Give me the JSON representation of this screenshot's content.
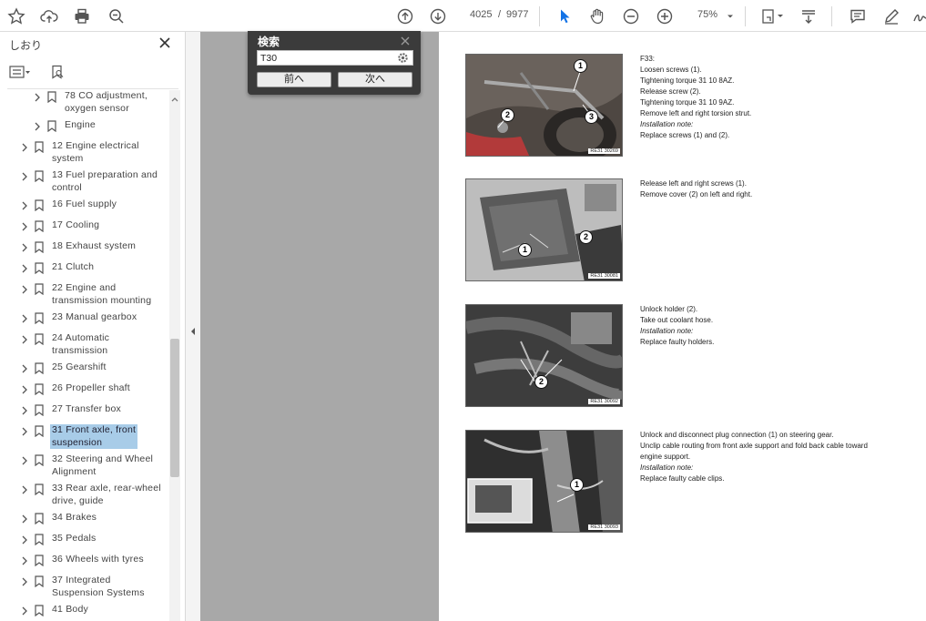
{
  "toolbar": {
    "page_current": "4025",
    "page_separator": "/",
    "page_total": "9977",
    "zoom": "75%",
    "icons": [
      "star-icon",
      "cloud-upload-icon",
      "print-icon",
      "zoom-search-icon",
      "arrow-up-circle-icon",
      "arrow-down-circle-icon",
      "cursor-icon",
      "hand-icon",
      "zoom-out-icon",
      "zoom-in-icon",
      "chevron-down-icon",
      "page-fit-icon",
      "scroll-mode-icon",
      "comment-icon",
      "pen-icon",
      "sign-icon"
    ]
  },
  "sidebar": {
    "title": "しおり",
    "items": [
      {
        "label": "78 CO adjustment,\noxygen sensor",
        "level": 2
      },
      {
        "label": "Engine",
        "level": 2
      },
      {
        "label": "12 Engine electrical\nsystem",
        "level": 1
      },
      {
        "label": "13 Fuel preparation and\ncontrol",
        "level": 1
      },
      {
        "label": "16 Fuel supply",
        "level": 1
      },
      {
        "label": "17 Cooling",
        "level": 1
      },
      {
        "label": "18 Exhaust system",
        "level": 1
      },
      {
        "label": "21 Clutch",
        "level": 1
      },
      {
        "label": "22 Engine and\ntransmission mounting",
        "level": 1
      },
      {
        "label": "23 Manual gearbox",
        "level": 1
      },
      {
        "label": "24 Automatic\ntransmission",
        "level": 1
      },
      {
        "label": "25 Gearshift",
        "level": 1
      },
      {
        "label": "26 Propeller shaft",
        "level": 1
      },
      {
        "label": "27 Transfer box",
        "level": 1
      },
      {
        "label": "31 Front axle, front\nsuspension",
        "level": 1,
        "selected": true
      },
      {
        "label": "32 Steering and Wheel\nAlignment",
        "level": 1
      },
      {
        "label": "33 Rear axle, rear-wheel\ndrive, guide",
        "level": 1
      },
      {
        "label": "34 Brakes",
        "level": 1
      },
      {
        "label": "35 Pedals",
        "level": 1
      },
      {
        "label": "36 Wheels with tyres",
        "level": 1
      },
      {
        "label": "37 Integrated\nSuspension Systems",
        "level": 1
      },
      {
        "label": "41 Body",
        "level": 1
      }
    ]
  },
  "find": {
    "title": "検索",
    "value": "T30",
    "prev_label": "前へ",
    "next_label": "次へ"
  },
  "page": {
    "steps": [
      {
        "ref": "RE31 30269",
        "callouts": [
          "1",
          "2",
          "3"
        ],
        "lines": [
          {
            "text": "F33:",
            "italic": false
          },
          {
            "text": "Loosen screws (1).",
            "italic": false
          },
          {
            "text": "Tightening torque 31 10 8AZ.",
            "italic": false
          },
          {
            "text": "Release screw (2).",
            "italic": false
          },
          {
            "text": "Tightening torque 31 10 9AZ.",
            "italic": false
          },
          {
            "text": "Remove left and right torsion strut.",
            "italic": false
          },
          {
            "text": "Installation note:",
            "italic": true
          },
          {
            "text": "Replace screws (1) and (2).",
            "italic": false
          }
        ]
      },
      {
        "ref": "RE31 30081",
        "callouts": [
          "1",
          "2"
        ],
        "lines": [
          {
            "text": "Release left and right screws (1).",
            "italic": false
          },
          {
            "text": "Remove cover (2) on left and right.",
            "italic": false
          }
        ]
      },
      {
        "ref": "RE31 30092",
        "callouts": [
          "2"
        ],
        "lines": [
          {
            "text": "Unlock holder (2).",
            "italic": false
          },
          {
            "text": "Take out coolant hose.",
            "italic": false
          },
          {
            "text": "Installation note:",
            "italic": true
          },
          {
            "text": "Replace faulty holders.",
            "italic": false
          }
        ]
      },
      {
        "ref": "RE31 30093",
        "callouts": [
          "1"
        ],
        "lines": [
          {
            "text": "Unlock and disconnect plug connection (1) on steering gear.",
            "italic": false
          },
          {
            "text": "Unclip cable routing from front axle support and fold back cable toward",
            "italic": false
          },
          {
            "text": "engine support.",
            "italic": false
          },
          {
            "text": "Installation note:",
            "italic": true
          },
          {
            "text": "Replace faulty cable clips.",
            "italic": false
          }
        ]
      }
    ]
  }
}
